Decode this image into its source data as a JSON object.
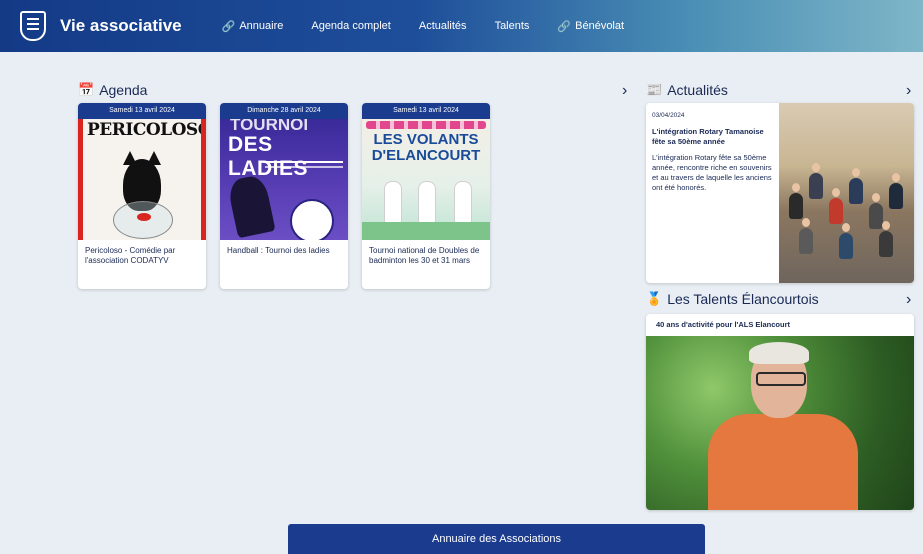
{
  "header": {
    "brand": "Vie associative",
    "nav": [
      {
        "label": "Annuaire",
        "icon": "link-icon"
      },
      {
        "label": "Agenda complet"
      },
      {
        "label": "Actualités"
      },
      {
        "label": "Talents"
      },
      {
        "label": "Bénévolat",
        "icon": "link-icon"
      }
    ]
  },
  "agenda": {
    "heading": "Agenda",
    "cards": [
      {
        "date": "Samedi 13 avril 2024",
        "title": "Pericoloso - Comédie par l'association CODATYV",
        "poster_title": "PERICOLOSO"
      },
      {
        "date": "Dimanche 28 avril 2024",
        "title": "Handball : Tournoi des ladies",
        "poster_line1": "TOURNOI",
        "poster_line2": "DES LADIES"
      },
      {
        "date": "Samedi 13 avril 2024",
        "title": "Tournoi national de Doubles de badminton les 30 et 31 mars",
        "poster_line1": "LES VOLANTS",
        "poster_line2": "D'ELANCOURT"
      }
    ]
  },
  "news": {
    "heading": "Actualités",
    "date": "03/04/2024",
    "title": "L'intégration Rotary Tamanoise fête sa 50ème année",
    "body": "L'intégration Rotary fête sa 50ème année, rencontre riche en souvenirs et au travers de laquelle les anciens ont été honorés."
  },
  "talents": {
    "heading": "Les Talents Élancourtois",
    "card_title": "40 ans d'activité pour l'ALS Elancourt"
  },
  "bottom_button": "Annuaire des Associations",
  "colors": {
    "primary": "#1a3b8e",
    "accent": "#e5783f"
  }
}
